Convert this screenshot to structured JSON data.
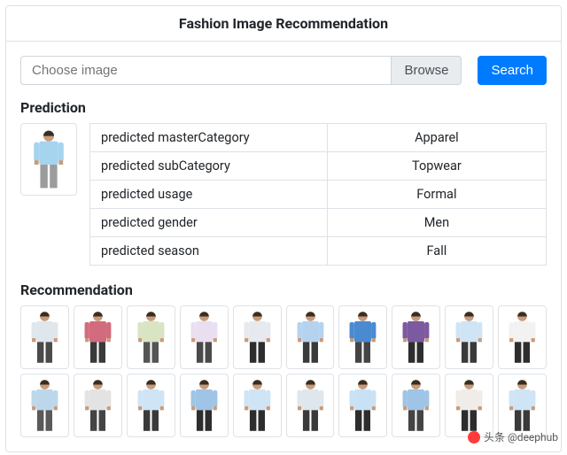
{
  "header": {
    "title": "Fashion Image Recommendation"
  },
  "search": {
    "placeholder": "Choose image",
    "browse_label": "Browse",
    "search_label": "Search"
  },
  "prediction": {
    "heading": "Prediction",
    "query_image": {
      "shirt_color": "#a6d4ee",
      "pants_color": "#9c9c9c"
    },
    "rows": [
      {
        "label": "predicted masterCategory",
        "value": "Apparel"
      },
      {
        "label": "predicted subCategory",
        "value": "Topwear"
      },
      {
        "label": "predicted usage",
        "value": "Formal"
      },
      {
        "label": "predicted gender",
        "value": "Men"
      },
      {
        "label": "predicted season",
        "value": "Fall"
      }
    ]
  },
  "recommendation": {
    "heading": "Recommendation",
    "items": [
      {
        "shirt_color": "#dfe6ec",
        "pants_color": "#4a4a4a"
      },
      {
        "shirt_color": "#d36b7e",
        "pants_color": "#3a3a3a"
      },
      {
        "shirt_color": "#d9e4c2",
        "pants_color": "#555555"
      },
      {
        "shirt_color": "#eadff0",
        "pants_color": "#4a4a4a"
      },
      {
        "shirt_color": "#e6e9ed",
        "pants_color": "#2d2d2d"
      },
      {
        "shirt_color": "#b5d3ef",
        "pants_color": "#3a3a3a"
      },
      {
        "shirt_color": "#4a8ad1",
        "pants_color": "#444444"
      },
      {
        "shirt_color": "#7c5aa0",
        "pants_color": "#2d2d2d"
      },
      {
        "shirt_color": "#cfe4f5",
        "pants_color": "#3a3a3a"
      },
      {
        "shirt_color": "#f2f2f2",
        "pants_color": "#2d2d2d"
      },
      {
        "shirt_color": "#bcd7ea",
        "pants_color": "#5a5a5a"
      },
      {
        "shirt_color": "#e3e3e3",
        "pants_color": "#444444"
      },
      {
        "shirt_color": "#cfe4f5",
        "pants_color": "#3a3a3a"
      },
      {
        "shirt_color": "#9fc4e6",
        "pants_color": "#2d2d2d"
      },
      {
        "shirt_color": "#cfe4f5",
        "pants_color": "#2d2d2d"
      },
      {
        "shirt_color": "#dfe6ec",
        "pants_color": "#3a3a3a"
      },
      {
        "shirt_color": "#c9e1f4",
        "pants_color": "#2d2d2d"
      },
      {
        "shirt_color": "#9fc4e6",
        "pants_color": "#444444"
      },
      {
        "shirt_color": "#f0ece7",
        "pants_color": "#2d2d2d"
      },
      {
        "shirt_color": "#cfe4f5",
        "pants_color": "#3a3a3a"
      }
    ]
  },
  "watermark": {
    "text": "头条 @deephub"
  }
}
